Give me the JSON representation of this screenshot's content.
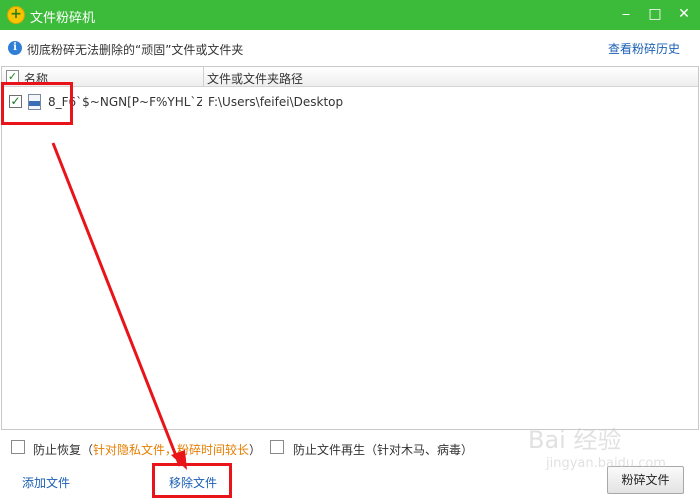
{
  "window": {
    "title": "文件粉碎机",
    "minimize_glyph": "⎯",
    "maximize_glyph": "□",
    "close_glyph": "✕",
    "app_icon_glyph": "+"
  },
  "info": {
    "icon_glyph": "i",
    "text": "彻底粉碎无法删除的“顽固”文件或文件夹",
    "history_link": "查看粉碎历史"
  },
  "table": {
    "header_check": "✓",
    "col_name": "名称",
    "col_path": "文件或文件夹路径",
    "rows": [
      {
        "checked": "✓",
        "name": "8_F6`$~NGN[P~F%YHL`Z...",
        "path": "F:\\Users\\feifei\\Desktop"
      }
    ]
  },
  "options": {
    "prevent_recovery": "防止恢复",
    "prevent_recovery_open": "（",
    "prevent_recovery_note": "针对隐私文件，粉碎时间较长",
    "prevent_recovery_close": "）",
    "prevent_regen": "防止文件再生（针对木马、病毒）"
  },
  "bottom": {
    "add_file": "添加文件",
    "remove_file": "移除文件",
    "shred_button": "粉碎文件"
  },
  "watermark": {
    "text": "Bai 经验",
    "sub": "jingyan.baidu.com"
  },
  "colors": {
    "title_bar": "#3cbb3a",
    "link": "#1b5fb4",
    "highlight": "#e8141a",
    "note": "#e67e00"
  }
}
